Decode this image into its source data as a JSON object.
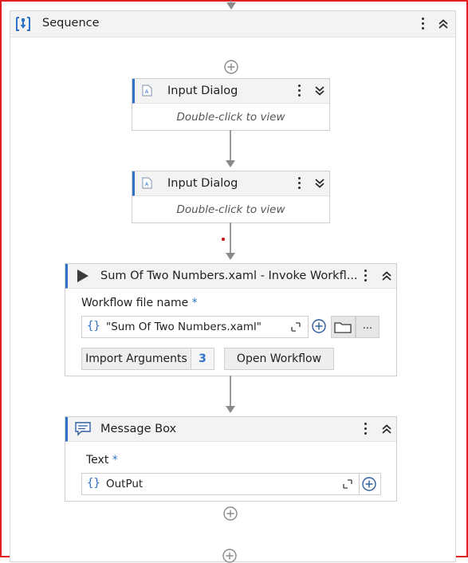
{
  "sequence": {
    "title": "Sequence",
    "icon": "sequence-icon"
  },
  "activities": [
    {
      "title": "Input Dialog",
      "hint": "Double-click to view",
      "icon": "input-dialog-icon",
      "collapsed": true
    },
    {
      "title": "Input Dialog",
      "hint": "Double-click to view",
      "icon": "input-dialog-icon",
      "collapsed": true
    }
  ],
  "invoke": {
    "title": "Sum Of Two Numbers.xaml - Invoke Workfl...",
    "icon": "play-icon",
    "field_label": "Workflow file name",
    "required_mark": "*",
    "brace": "{}",
    "file_value": "\"Sum Of Two Numbers.xaml\"",
    "more_label": "...",
    "import_label": "Import Arguments",
    "import_count": "3",
    "open_label": "Open Workflow"
  },
  "message_box": {
    "title": "Message Box",
    "icon": "message-icon",
    "field_label": "Text",
    "required_mark": "*",
    "brace": "{}",
    "text_value": "OutPut"
  },
  "colors": {
    "accent": "#2e73c7",
    "frame": "#e02020",
    "connector": "#9b9b9b"
  }
}
